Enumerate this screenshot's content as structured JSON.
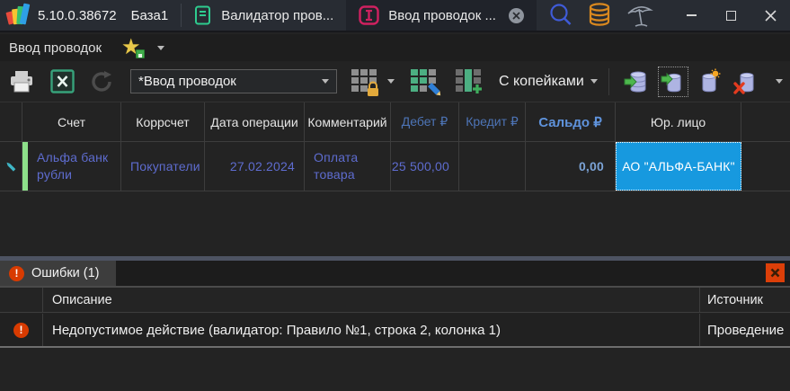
{
  "title_bar": {
    "version": "5.10.0.38672",
    "database": "База1",
    "tabs": [
      {
        "label": "Валидатор пров...",
        "active": false
      },
      {
        "label": "Ввод проводок ...",
        "active": true
      }
    ]
  },
  "favorites_bar": {
    "label": "Ввод проводок"
  },
  "toolbar": {
    "view_selector_value": "*Ввод проводок",
    "kopecks_label": "С копейками"
  },
  "grid": {
    "columns": [
      "",
      "Счет",
      "Коррсчет",
      "Дата операции",
      "Комментарий",
      "Дебет ₽",
      "Кредит ₽",
      "Сальдо ₽",
      "Юр. лицо",
      ""
    ],
    "row": {
      "account": "Альфа банк рубли",
      "corr_account": "Покупатели",
      "date": "27.02.2024",
      "comment": "Оплата товара",
      "debit": "25 500,00",
      "credit": "",
      "balance": "0,00",
      "legal_entity": "АО \"АЛЬФА-БАНК\""
    }
  },
  "errors_panel": {
    "tab_label": "Ошибки (1)",
    "badge": "!",
    "columns": {
      "description": "Описание",
      "source": "Источник"
    },
    "row": {
      "description": "Недопустимое действие (валидатор: Правило №1, строка 2, колонка 1)",
      "source": "Проведение"
    }
  },
  "colors": {
    "selected_cell": "#1799df",
    "data_text": "#5e6ccf",
    "balance_text": "#7ba3d6",
    "error_accent": "#d83b01",
    "row_marker_green": "#8de08a",
    "splitter": "#4d5362"
  }
}
